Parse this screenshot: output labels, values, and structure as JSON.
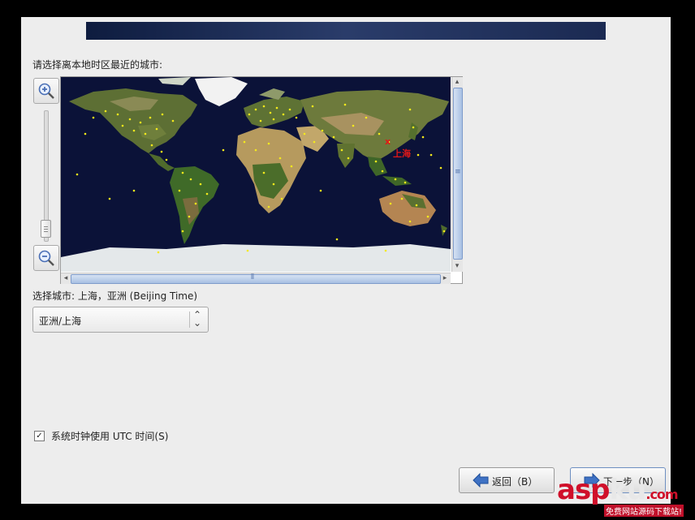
{
  "prompt": "请选择离本地时区最近的城市:",
  "map": {
    "selected_city_label": "上海",
    "selected_marker": "x",
    "zoom_in_icon": "zoom-in-icon",
    "zoom_out_icon": "zoom-out-icon"
  },
  "city_selection": {
    "label": "选择城市: 上海，亚洲 (Beijing Time)",
    "combo_value": "亚洲/上海"
  },
  "utc_checkbox": {
    "label": "系统时钟使用 UTC 时间(S)",
    "checked": true,
    "check_mark": "☑"
  },
  "buttons": {
    "back_label": "返回（B）",
    "next_label": "下一步（N）"
  },
  "watermark": {
    "brand": "aspku",
    "tld": ".com",
    "slogan": "免费网站源码下载站!"
  }
}
